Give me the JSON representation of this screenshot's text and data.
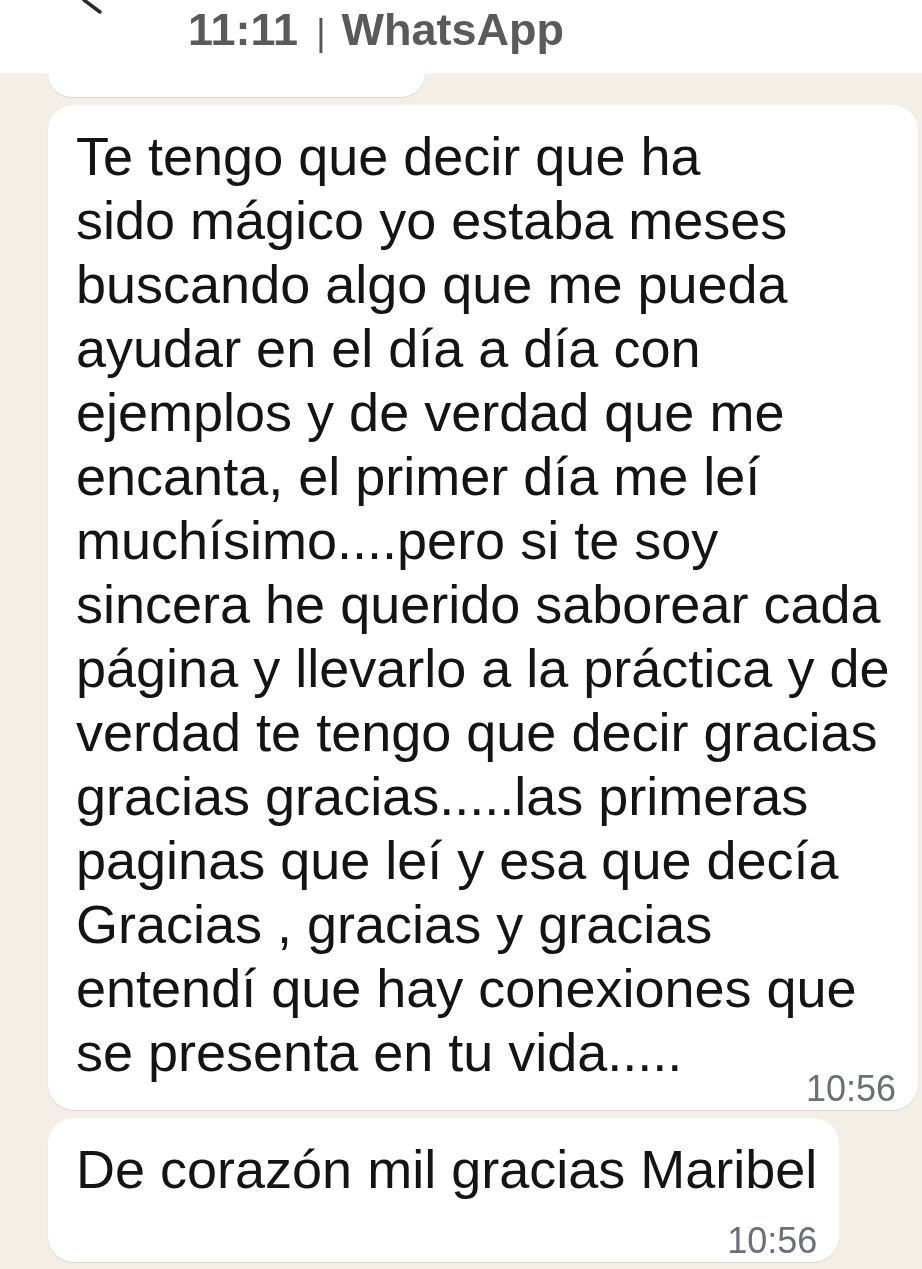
{
  "header": {
    "clock": "11:11",
    "separator": "|",
    "app_name": "WhatsApp"
  },
  "messages": [
    {
      "kind": "cut_off"
    },
    {
      "kind": "text",
      "text": "Te tengo que decir que ha\nsido mágico yo estaba meses buscando algo que me pueda ayudar en el día a día con ejemplos y de verdad que me encanta, el primer día me leí muchísimo....pero si te soy sincera he querido saborear cada página y llevarlo a la práctica y de verdad te tengo que decir gracias gracias gracias.....las primeras paginas que leí y esa que decía Gracias , gracias y gracias entendí que hay conexiones que se presenta en tu vida.....",
      "time": "10:56"
    },
    {
      "kind": "text",
      "text": "De corazón mil gracias Maribel",
      "time": "10:56"
    }
  ]
}
